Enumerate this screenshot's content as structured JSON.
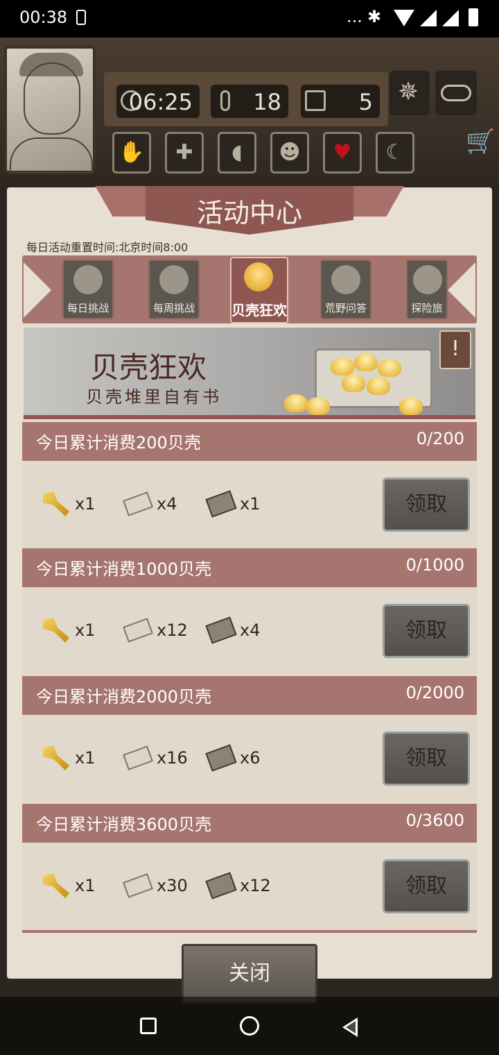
{
  "status_bar": {
    "time": "00:38",
    "more": "...",
    "bt": "✱"
  },
  "hud": {
    "clock": "06:25",
    "temperature": "18",
    "day": "5",
    "season_icon": "leaf-icon",
    "weather_icon": "cloud-icon"
  },
  "panel": {
    "title": "活动中心",
    "reset_note": "每日活动重置时间:北京时间8:00",
    "tabs": [
      {
        "label": "每日挑战"
      },
      {
        "label": "每周挑战"
      },
      {
        "label": "贝壳狂欢"
      },
      {
        "label": "荒野问答"
      },
      {
        "label": "探险旅"
      }
    ],
    "active_tab": 2,
    "banner": {
      "title": "贝壳狂欢",
      "subtitle": "贝壳堆里自有书",
      "info": "!"
    },
    "tasks": [
      {
        "name": "今日累计消费200贝壳",
        "progress": "0/200",
        "rewards": [
          "x1",
          "x4",
          "x1"
        ],
        "claim": "领取"
      },
      {
        "name": "今日累计消费1000贝壳",
        "progress": "0/1000",
        "rewards": [
          "x1",
          "x12",
          "x4"
        ],
        "claim": "领取"
      },
      {
        "name": "今日累计消费2000贝壳",
        "progress": "0/2000",
        "rewards": [
          "x1",
          "x16",
          "x6"
        ],
        "claim": "领取"
      },
      {
        "name": "今日累计消费3600贝壳",
        "progress": "0/3600",
        "rewards": [
          "x1",
          "x30",
          "x12"
        ],
        "claim": "领取"
      }
    ],
    "close": "关闭"
  },
  "reward_icons": [
    "key-icon",
    "paper-icon",
    "book-icon"
  ],
  "colors": {
    "accent": "#a7756f",
    "ribbon": "#8e5752",
    "panel": "#e6dfd2"
  }
}
